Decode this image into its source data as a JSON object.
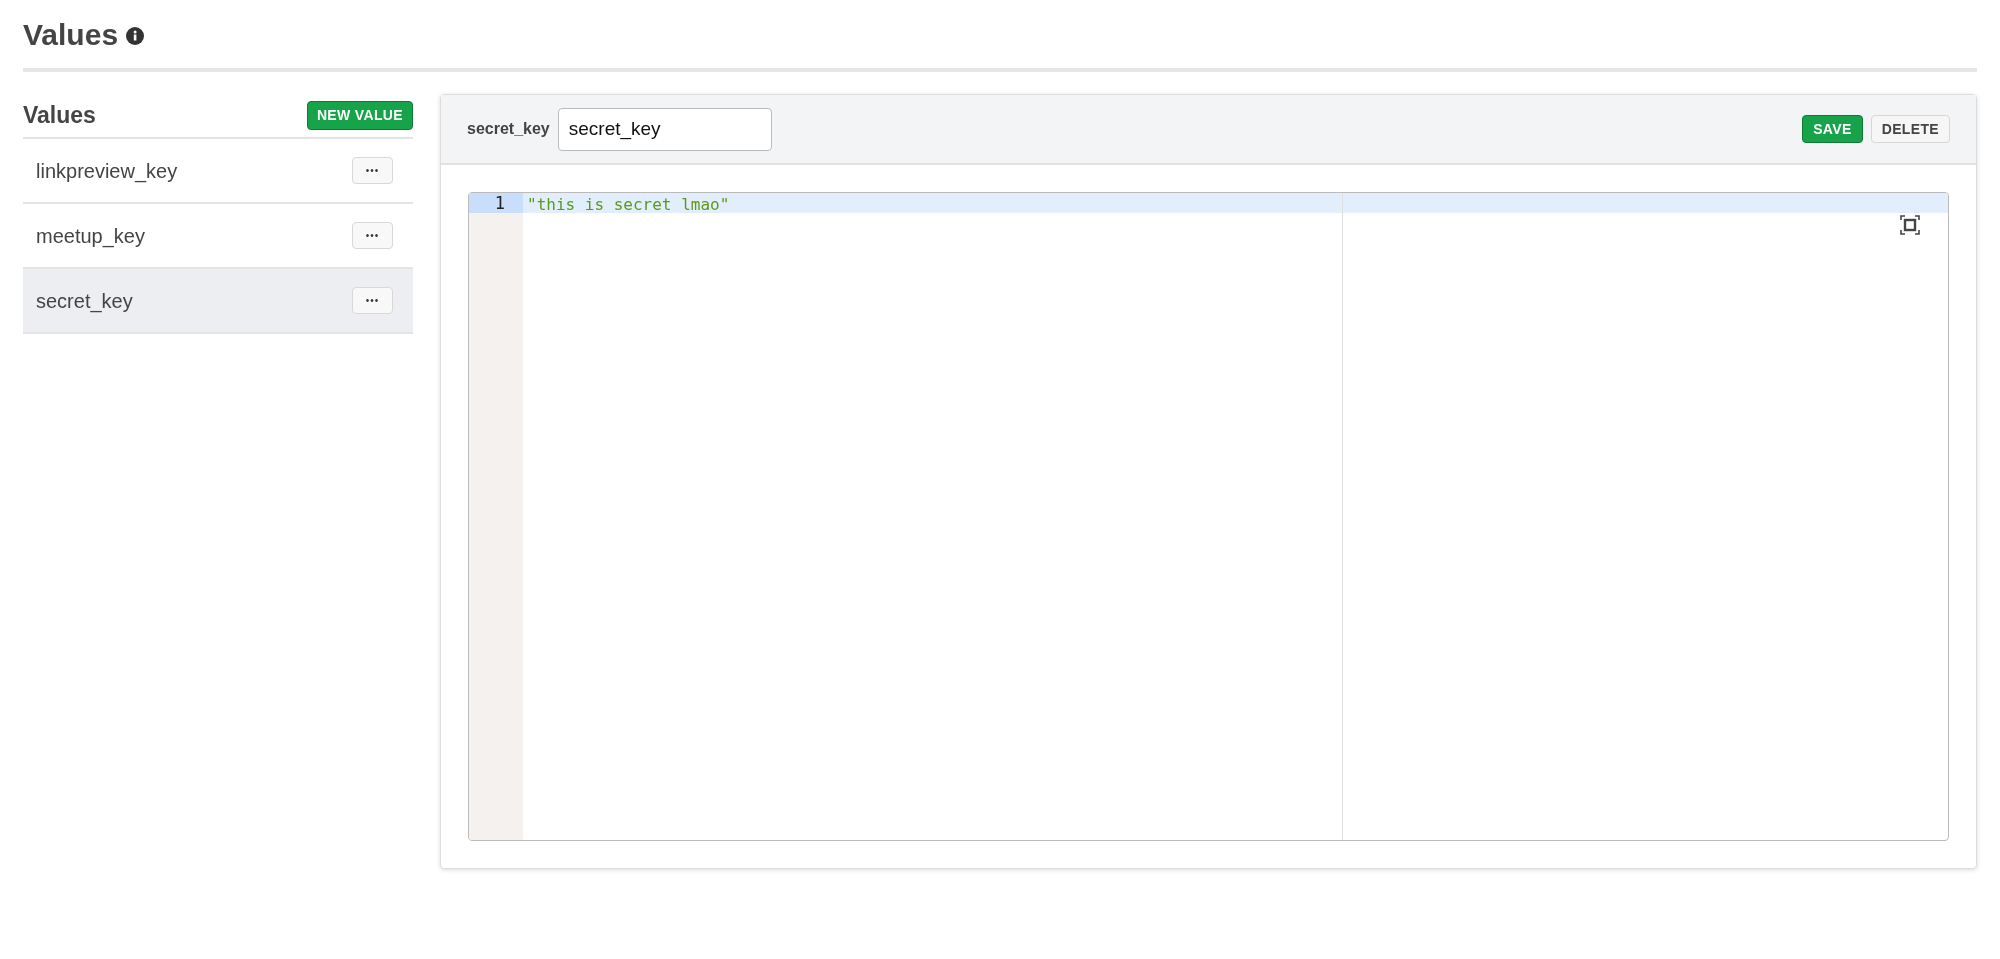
{
  "page": {
    "title": "Values"
  },
  "sidebar": {
    "title": "Values",
    "new_button": "NEW VALUE",
    "items": [
      {
        "name": "linkpreview_key",
        "menu": "•••",
        "selected": false
      },
      {
        "name": "meetup_key",
        "menu": "•••",
        "selected": false
      },
      {
        "name": "secret_key",
        "menu": "•••",
        "selected": true
      }
    ]
  },
  "editor": {
    "key_label": "secret_key",
    "key_value": "secret_key",
    "buttons": [
      {
        "label": "SAVE",
        "kind": "primary"
      },
      {
        "label": "DELETE",
        "kind": "secondary"
      }
    ],
    "lines": [
      {
        "number": "1",
        "text": "\"this is secret lmao\"",
        "active": true
      }
    ]
  }
}
